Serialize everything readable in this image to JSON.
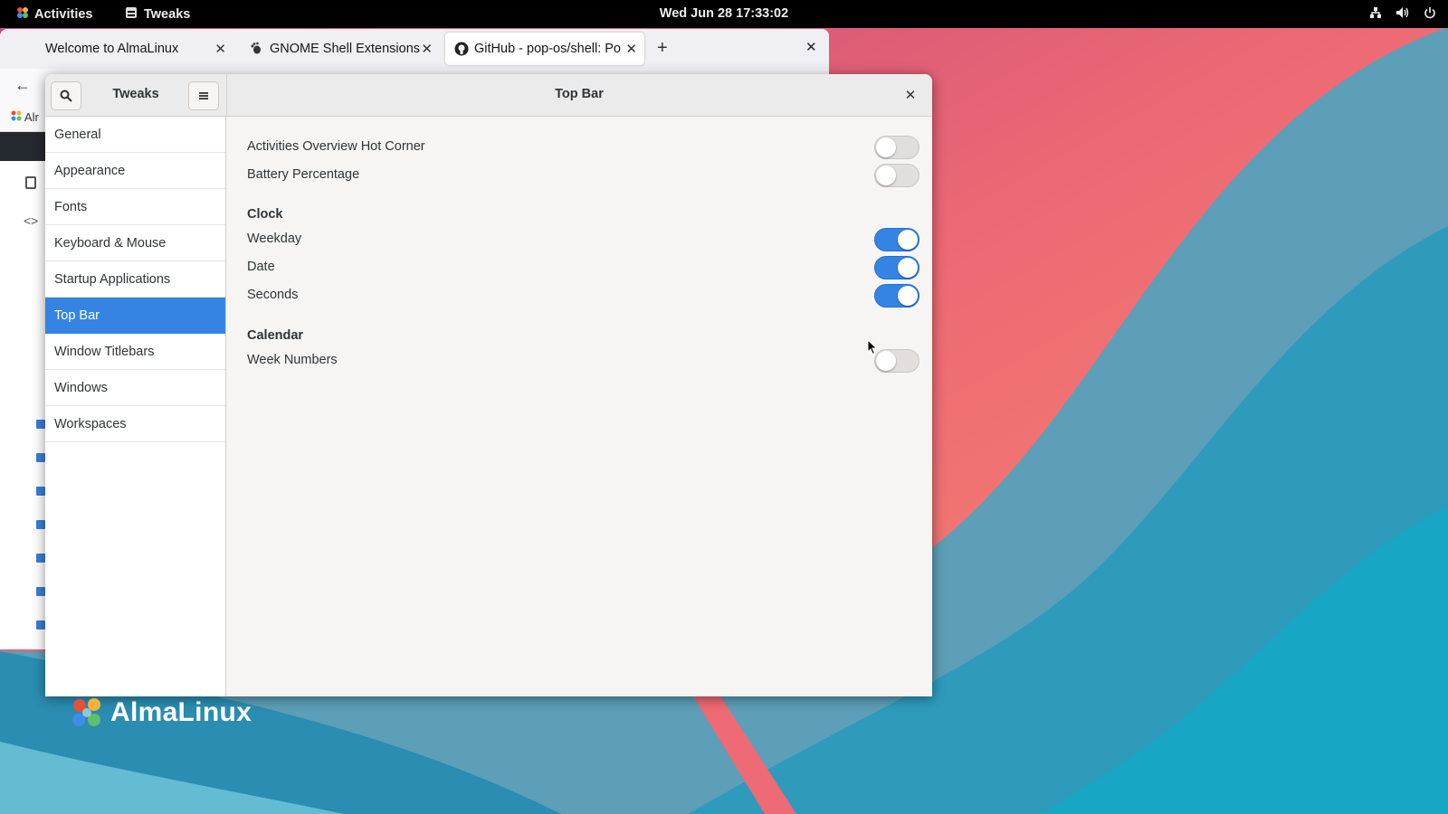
{
  "topbar": {
    "activities_label": "Activities",
    "app_label": "Tweaks",
    "clock": "Wed Jun 28  17:33:02"
  },
  "browser": {
    "tabs": [
      {
        "label": "Welcome to AlmaLinux"
      },
      {
        "label": "GNOME Shell Extensions"
      },
      {
        "label": "GitHub - pop-os/shell: Po"
      }
    ],
    "bookmark_label": "Alr"
  },
  "tweaks": {
    "app_title": "Tweaks",
    "page_title": "Top Bar",
    "sidebar": [
      {
        "label": "General",
        "selected": false
      },
      {
        "label": "Appearance",
        "selected": false
      },
      {
        "label": "Fonts",
        "selected": false
      },
      {
        "label": "Keyboard & Mouse",
        "selected": false
      },
      {
        "label": "Startup Applications",
        "selected": false
      },
      {
        "label": "Top Bar",
        "selected": true
      },
      {
        "label": "Window Titlebars",
        "selected": false
      },
      {
        "label": "Windows",
        "selected": false
      },
      {
        "label": "Workspaces",
        "selected": false
      }
    ],
    "settings": {
      "hot_corner": {
        "label": "Activities Overview Hot Corner",
        "on": false
      },
      "battery": {
        "label": "Battery Percentage",
        "on": false
      },
      "clock_header": "Clock",
      "weekday": {
        "label": "Weekday",
        "on": true
      },
      "date": {
        "label": "Date",
        "on": true
      },
      "seconds": {
        "label": "Seconds",
        "on": true
      },
      "calendar_header": "Calendar",
      "week_numbers": {
        "label": "Week Numbers",
        "on": false
      }
    }
  },
  "desktop": {
    "brand": "AlmaLinux"
  },
  "colors": {
    "accent": "#3584e4",
    "panel": "#000000",
    "window_bg": "#f6f5f4"
  }
}
